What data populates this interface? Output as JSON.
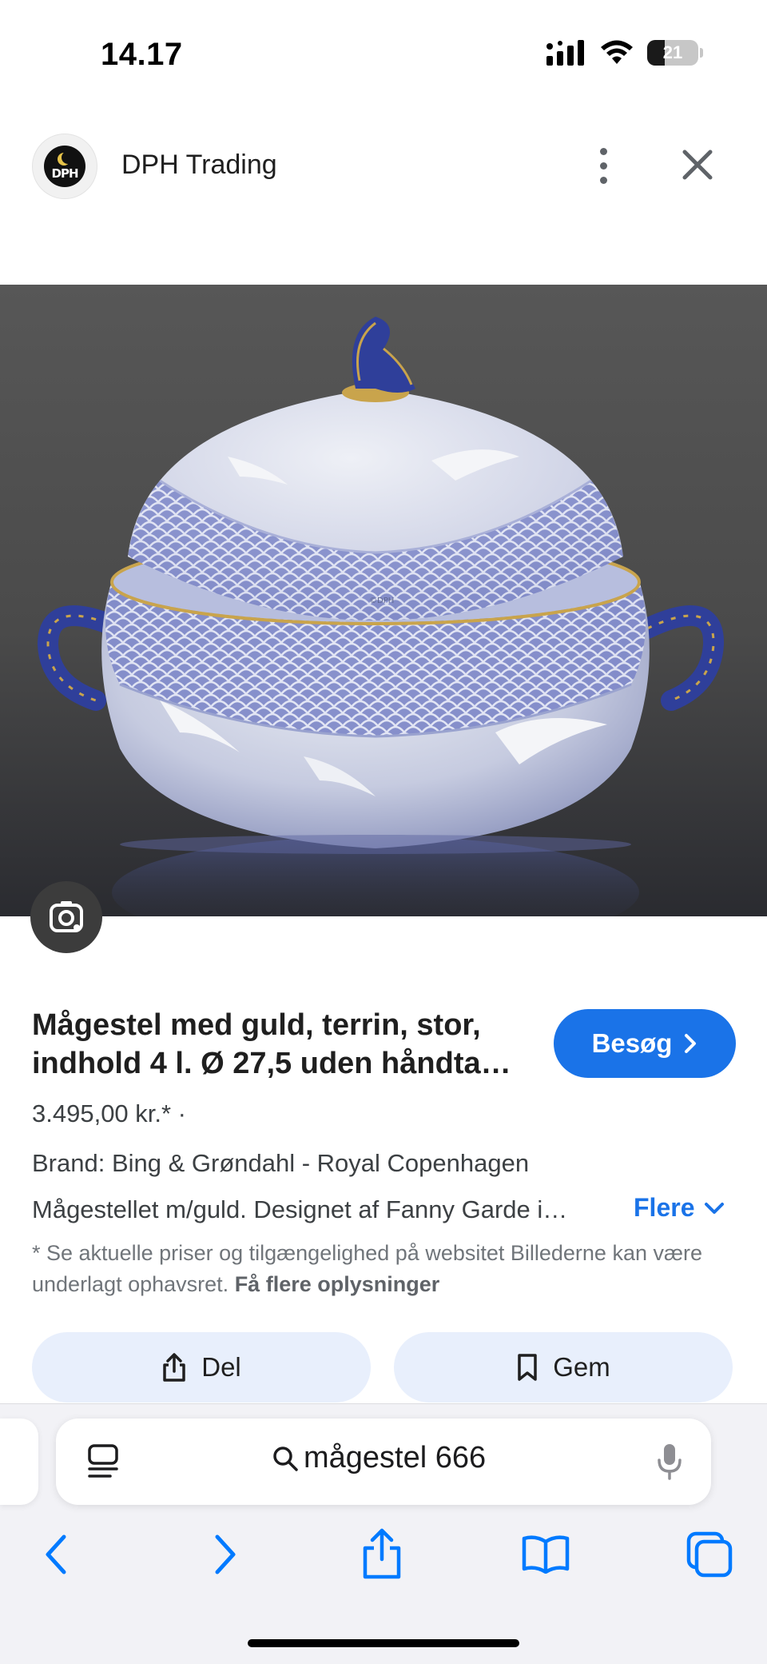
{
  "status_bar": {
    "time": "14.17",
    "battery": "21"
  },
  "source": {
    "logo_text": "DPH",
    "site_name": "DPH Trading"
  },
  "product": {
    "title": "Mågestel med guld, terrin, stor, indhold 4 l. Ø 27,5 uden håndta…",
    "price": "3.495,00 kr.* ·",
    "brand": "Brand: Bing & Grøndahl - Royal Copenhagen",
    "description": "Mågestellet m/guld. Designet af Fanny Garde i…",
    "more_label": "Flere",
    "disclaimer": "* Se aktuelle priser og tilgængelighed på websitet Billederne kan være underlagt ophavsret.",
    "disclaimer_link": "Få flere oplysninger",
    "visit_label": "Besøg",
    "watermark": "©DPH"
  },
  "actions": {
    "share_label": "Del",
    "save_label": "Gem"
  },
  "address_bar": {
    "query": "mågestel 666"
  },
  "icons": {
    "signal": "cellular-signal-icon",
    "wifi": "wifi-icon",
    "battery": "battery-icon",
    "more": "more-vertical-icon",
    "close": "close-icon",
    "lens": "google-lens-icon",
    "chevron_right": "chevron-right-icon",
    "chevron_down": "chevron-down-icon",
    "share": "share-icon",
    "bookmark": "bookmark-icon",
    "reader": "reader-mode-icon",
    "search": "search-icon",
    "mic": "microphone-icon",
    "back": "back-arrow-icon",
    "forward": "forward-arrow-icon",
    "bookmarks": "bookmarks-book-icon",
    "tabs": "tabs-icon"
  },
  "colors": {
    "accent": "#1a73e8",
    "action_button_bg": "#e8effc",
    "safari_toolbar": "#007aff"
  }
}
